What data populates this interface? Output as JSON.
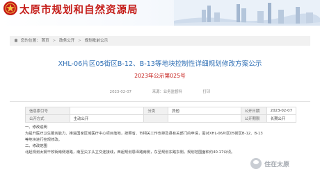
{
  "header": {
    "bureau_name": "太原市规划和自然资源局"
  },
  "breadcrumb": {
    "prefix": "您的位置：",
    "items": [
      "首页",
      "政务公开",
      "规划批前公示"
    ]
  },
  "notice": {
    "title": "XHL-06片区05街区B-12、B-13等地块控制性详细规划修改方案公示",
    "doc_number": "2023年公示第025号",
    "date_label": "2023-02-07",
    "source_label": "来源：业务监督科",
    "print_label": "打印"
  },
  "info_table": {
    "rows": [
      [
        "信息索引号",
        "",
        "分类",
        "其他",
        "公开日期",
        "2023-02-07"
      ],
      [
        "公开方式",
        "主动公开",
        "",
        "",
        "公开期限",
        "长期公开"
      ]
    ]
  },
  "body": {
    "heading1": "一、修改说明",
    "para1a": "为提升医疗卫生服务能力、推进国家区域医疗中心项目落地，按照省、市相关工作安排及县有关部门的申请，需对XHL-06片区05街区B-12、B-13",
    "para1b": "等地块进行控规修改。",
    "heading2": "二、修改范围",
    "para2": "北起规划太钢干校街南侧道路，南至尖子头立交连接线，西起规划恩泽路南侧，东至规划东路东侧。规划范围面积约40.17公顷。"
  },
  "watermark": {
    "text": "住在太原"
  },
  "colors": {
    "brand_red": "#c41a16",
    "title_blue": "#2f6fb5"
  }
}
